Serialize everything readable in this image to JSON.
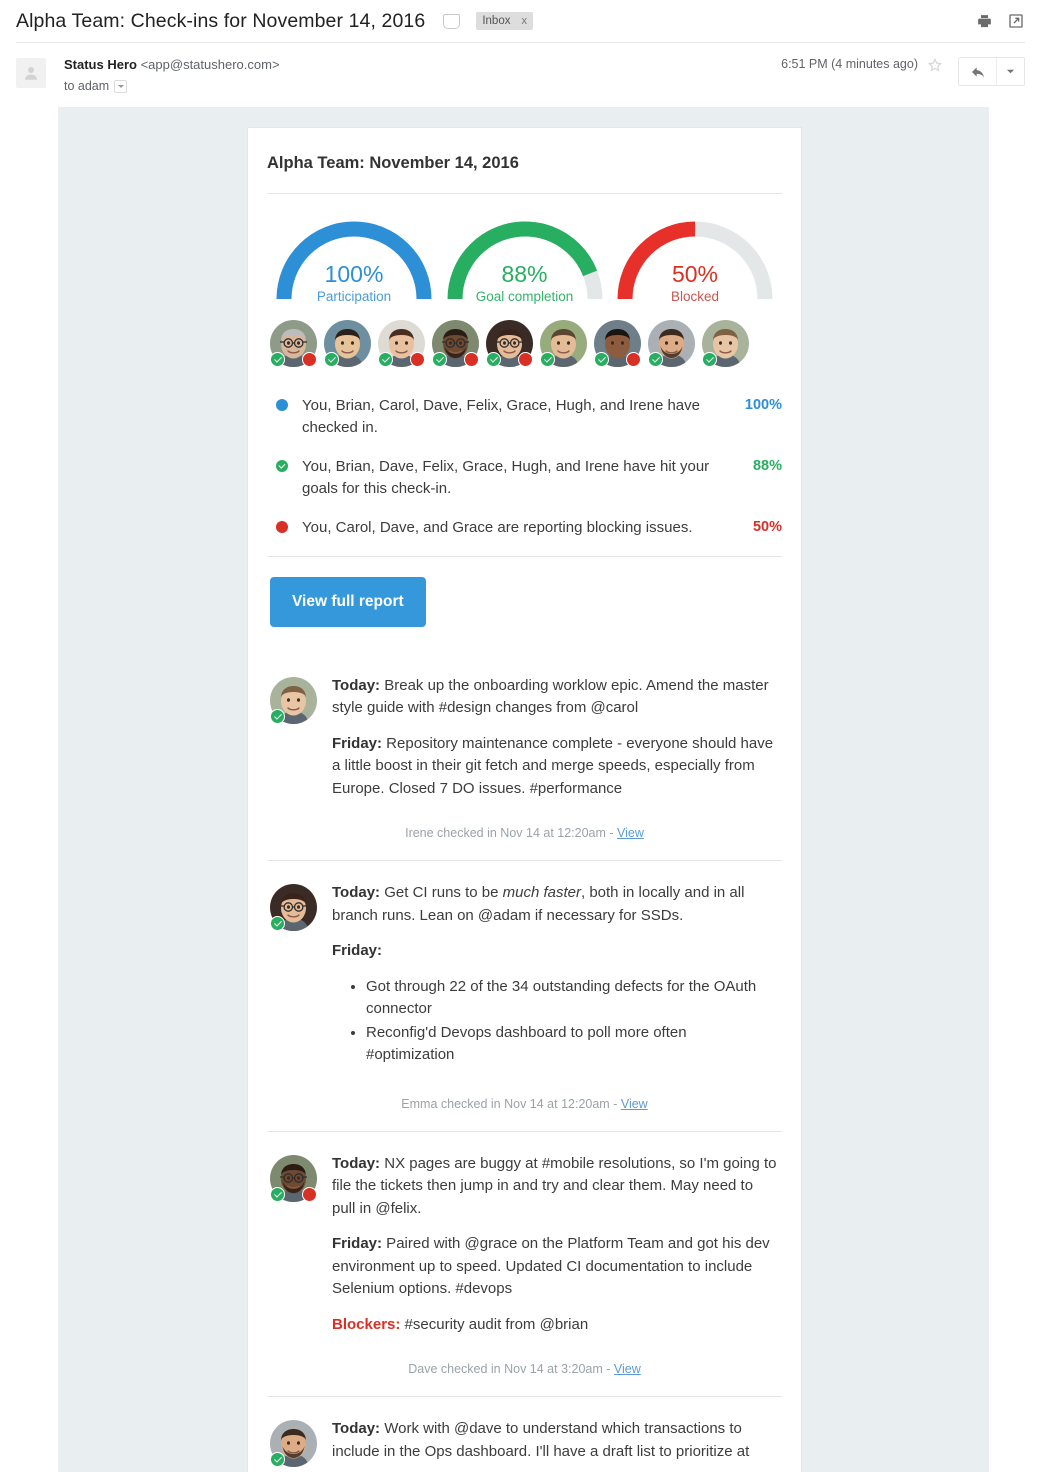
{
  "mail": {
    "subject": "Alpha Team: Check-ins for November 14, 2016",
    "label": "Inbox",
    "label_close": "x",
    "print_icon": "print-icon",
    "popout_icon": "open-in-new-window-icon",
    "sender_name": "Status Hero",
    "sender_email": "<app@statushero.com>",
    "recipient": "to adam",
    "timestamp": "6:51 PM (4 minutes ago)",
    "star_icon": "star-icon",
    "reply_icon": "reply-icon",
    "more_icon": "chevron-down-icon"
  },
  "report": {
    "title": "Alpha Team: November 14, 2016",
    "cta_label": "View full report",
    "gauges": [
      {
        "value": 100,
        "pct_label": "100%",
        "caption": "Participation",
        "color": "#2d8fd5"
      },
      {
        "value": 88,
        "pct_label": "88%",
        "caption": "Goal completion",
        "color": "#27ae60"
      },
      {
        "value": 50,
        "pct_label": "50%",
        "caption": "Blocked",
        "color": "#e8302a"
      }
    ],
    "track_color": "#e4e7e8",
    "members": [
      {
        "name": "member-1",
        "checked_in": true,
        "blocked": true,
        "skin": "#d9b79a",
        "hair": "#bdbdbd",
        "bg": "#8d9b88",
        "glasses": true,
        "beard": false
      },
      {
        "name": "member-2",
        "checked_in": true,
        "blocked": false,
        "skin": "#e7c39a",
        "hair": "#2b2119",
        "bg": "#6d8fa0",
        "glasses": false,
        "beard": false
      },
      {
        "name": "member-3",
        "checked_in": true,
        "blocked": true,
        "skin": "#e9c0a0",
        "hair": "#4a2f21",
        "bg": "#dedad4",
        "glasses": false,
        "beard": false
      },
      {
        "name": "member-4",
        "checked_in": true,
        "blocked": true,
        "skin": "#6e4a33",
        "hair": "#2b1d14",
        "bg": "#7e8a6f",
        "glasses": true,
        "beard": true
      },
      {
        "name": "member-5",
        "checked_in": true,
        "blocked": true,
        "skin": "#e6bb97",
        "hair": "#39231a",
        "bg": "#3a2b26",
        "glasses": true,
        "beard": false
      },
      {
        "name": "member-6",
        "checked_in": true,
        "blocked": false,
        "skin": "#e3bb96",
        "hair": "#5c4632",
        "bg": "#98ab7d",
        "glasses": false,
        "beard": false
      },
      {
        "name": "member-7",
        "checked_in": true,
        "blocked": true,
        "skin": "#8d5c3e",
        "hair": "#1b1512",
        "bg": "#6e7f89",
        "glasses": false,
        "beard": false
      },
      {
        "name": "member-8",
        "checked_in": true,
        "blocked": false,
        "skin": "#ddab85",
        "hair": "#3b2a1d",
        "bg": "#aab0b3",
        "glasses": false,
        "beard": true
      },
      {
        "name": "member-9",
        "checked_in": true,
        "blocked": false,
        "skin": "#e8c5a4",
        "hair": "#7e6243",
        "bg": "#a9b39c",
        "glasses": false,
        "beard": false
      }
    ],
    "summary": [
      {
        "icon": "blue-dot-icon",
        "style": "blue",
        "text": "You, Brian, Carol, Dave, Felix, Grace, Hugh, and Irene have checked in.",
        "pct": "100%"
      },
      {
        "icon": "green-check-icon",
        "style": "green",
        "text": "You, Brian, Dave, Felix, Grace, Hugh, and Irene have hit your goals for this check-in.",
        "pct": "88%"
      },
      {
        "icon": "red-dot-icon",
        "style": "red",
        "text": "You, Carol, Dave, and Grace are reporting blocking issues.",
        "pct": "50%"
      }
    ],
    "entries": [
      {
        "avatar": {
          "skin": "#e8c5a4",
          "hair": "#7e6243",
          "bg": "#a9b39c",
          "glasses": false,
          "beard": false
        },
        "checked_in": true,
        "blocked": false,
        "today_label": "Today:",
        "today_text": " Break up the onboarding worklow epic. Amend the master style guide with #design changes from @carol",
        "friday_label": "Friday:",
        "friday_text": " Repository maintenance complete - everyone should have a little boost in their git fetch and merge speeds, especially from Europe. Closed 7 DO issues. #performance",
        "bullets": [],
        "blockers_label": "",
        "blockers_text": "",
        "meta": "Irene checked in Nov 14 at 12:20am - ",
        "meta_link": "View"
      },
      {
        "avatar": {
          "skin": "#e6bb97",
          "hair": "#39231a",
          "bg": "#3a2b26",
          "glasses": true,
          "beard": false
        },
        "checked_in": true,
        "blocked": false,
        "today_label": "Today:",
        "today_text_pre": " Get CI runs to be ",
        "today_em": "much faster",
        "today_text_post": ", both in locally and in all branch runs. Lean on @adam if necessary for SSDs.",
        "friday_label": "Friday:",
        "friday_text": "",
        "bullets": [
          "Got through 22 of the 34 outstanding defects for the OAuth connector",
          "Reconfig'd Devops dashboard to poll more often #optimization"
        ],
        "blockers_label": "",
        "blockers_text": "",
        "meta": "Emma checked in Nov 14 at 12:20am - ",
        "meta_link": "View"
      },
      {
        "avatar": {
          "skin": "#6e4a33",
          "hair": "#2b1d14",
          "bg": "#7e8a6f",
          "glasses": true,
          "beard": true
        },
        "checked_in": true,
        "blocked": true,
        "today_label": "Today:",
        "today_text": " NX pages are buggy at #mobile resolutions, so I'm going to file the tickets then jump in and try and clear them. May need to pull in @felix.",
        "friday_label": "Friday:",
        "friday_text": " Paired with @grace on the Platform Team and got his dev environment up to speed. Updated CI documentation to include Selenium options. #devops",
        "bullets": [],
        "blockers_label": "Blockers:",
        "blockers_text": " #security audit from @brian",
        "meta": "Dave checked in Nov 14 at 3:20am - ",
        "meta_link": "View"
      },
      {
        "avatar": {
          "skin": "#ddab85",
          "hair": "#3b2a1d",
          "bg": "#aab0b3",
          "glasses": false,
          "beard": true
        },
        "checked_in": true,
        "blocked": false,
        "today_label": "Today:",
        "today_text": " Work with @dave to understand which transactions to include in the Ops dashboard. I'll have a draft list to prioritize at",
        "friday_label": "",
        "friday_text": "",
        "bullets": [],
        "blockers_label": "",
        "blockers_text": "",
        "meta": "",
        "meta_link": ""
      }
    ]
  },
  "chart_data": {
    "type": "pie",
    "title": "Alpha Team: November 14, 2016",
    "gauges": [
      {
        "label": "Participation",
        "value": 100,
        "max": 100,
        "color": "#2d8fd5"
      },
      {
        "label": "Goal completion",
        "value": 88,
        "max": 100,
        "color": "#27ae60"
      },
      {
        "label": "Blocked",
        "value": 50,
        "max": 100,
        "color": "#e8302a"
      }
    ],
    "legend_position": "below-arc",
    "grid": false
  }
}
